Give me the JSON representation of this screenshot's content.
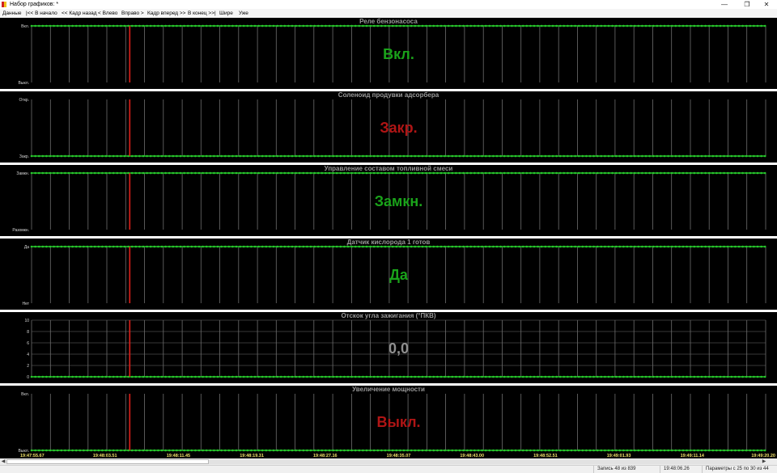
{
  "window": {
    "title": "Набор графиков: *",
    "minimize_icon": "minimize-icon",
    "maximize_icon": "restore-icon",
    "close_icon": "close-icon"
  },
  "menu": {
    "items": [
      "Данные",
      "|<< В начало",
      "<< Кадр назад",
      "< Влево",
      "Вправо >",
      "Кадр вперед >>",
      "В конец >>|",
      "Шире",
      "Уже"
    ]
  },
  "panels": [
    {
      "title": "Реле бензонасоса",
      "y_top_label": "Вкл.",
      "y_bottom_label": "Выкл.",
      "status": "Вкл.",
      "status_color": "#1aa31a",
      "signal_level": 1
    },
    {
      "title": "Соленоид продувки адсорбера",
      "y_top_label": "Откр.",
      "y_bottom_label": "Закр.",
      "status": "Закр.",
      "status_color": "#b01515",
      "signal_level": 0
    },
    {
      "title": "Управление составом топливной смеси",
      "y_top_label": "Замкн.",
      "y_bottom_label": "Разомкн.",
      "status": "Замкн.",
      "status_color": "#1aa31a",
      "signal_level": 1
    },
    {
      "title": "Датчик кислорода 1 готов",
      "y_top_label": "Да",
      "y_bottom_label": "Нет",
      "status": "Да",
      "status_color": "#1aa31a",
      "signal_level": 1
    },
    {
      "title": "Отскок угла зажигания  (°ПКВ)",
      "y_ticks": [
        "10",
        "8",
        "6",
        "4",
        "2",
        "0"
      ],
      "y_min": 0,
      "y_max": 10,
      "status": "0,0",
      "status_color": "#8f8f8f",
      "signal_value": 0
    },
    {
      "title": "Увеличение мощности",
      "y_top_label": "Вкл.",
      "y_bottom_label": "Выкл.",
      "status": "Выкл.",
      "status_color": "#b01515",
      "signal_level": 0
    }
  ],
  "time_axis": [
    "19:47:55.67",
    "19:48:03.51",
    "19:48:11.45",
    "19:48:19.31",
    "19:48:27.16",
    "19:48:35.07",
    "19:48:43.00",
    "19:48:52.51",
    "19:49:01.93",
    "19:49:11.14",
    "19:49:20.20"
  ],
  "colors": {
    "signal": "#27c82c",
    "cursor": "#e0201a",
    "grid": "#6e6e6e",
    "background": "#000000"
  },
  "statusbar": {
    "record": "Запись 48 из 839",
    "time": "19:48:06.26",
    "params": "Параметры с 25 по 30 из 44"
  }
}
